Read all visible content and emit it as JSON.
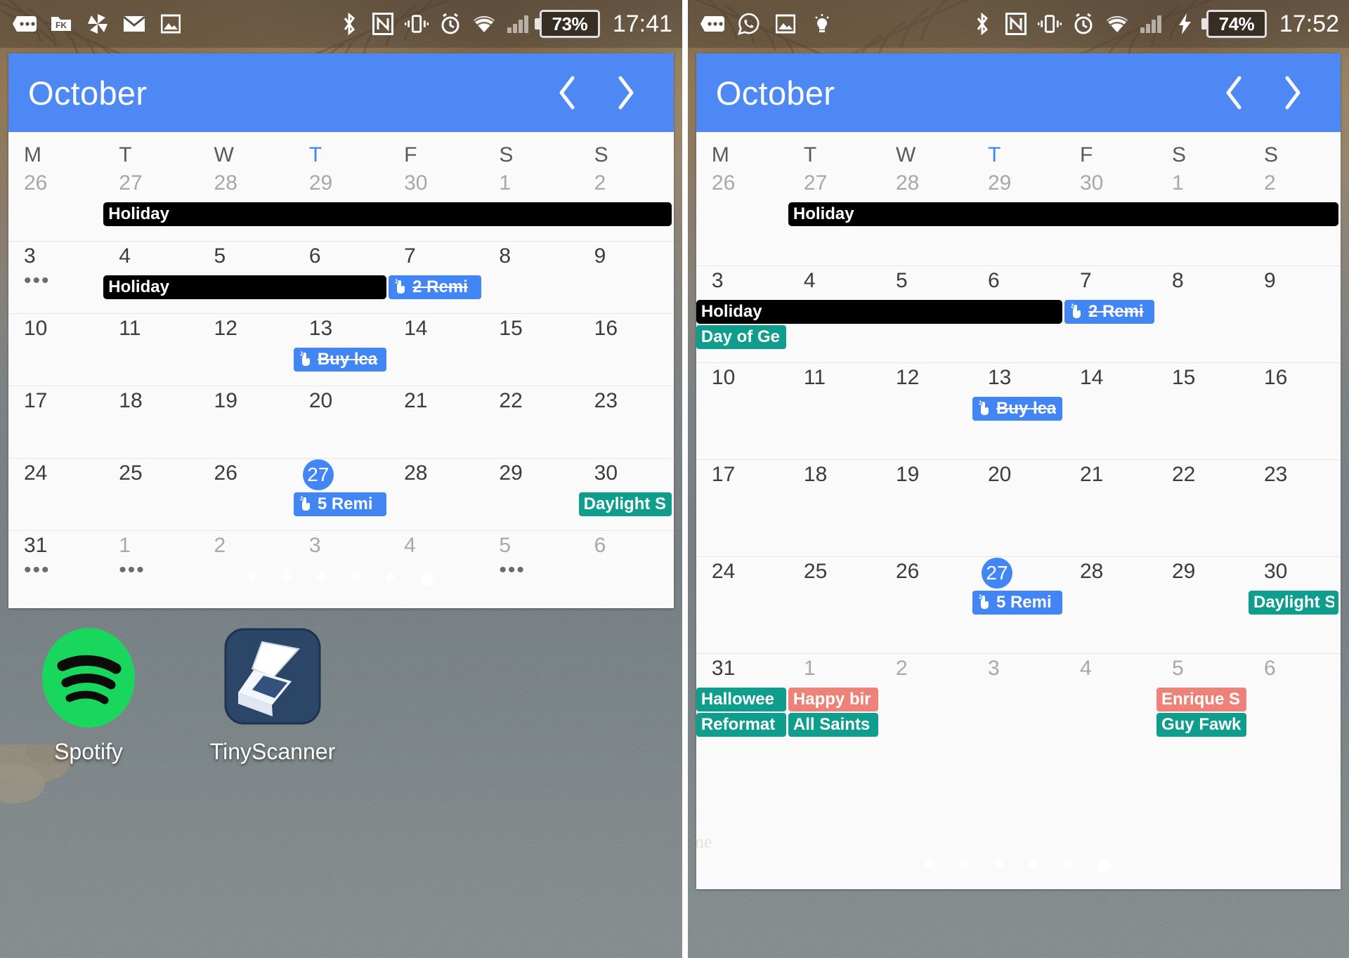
{
  "panels": [
    {
      "id": "left",
      "status_bar": {
        "left_icons": [
          "messages-icon",
          "fk-folder-icon",
          "pinwheel-icon",
          "email-icon",
          "photo-icon"
        ],
        "right_icons": [
          "bluetooth-icon",
          "nfc-icon",
          "vibrate-icon",
          "alarm-icon",
          "wifi-icon",
          "signal-icon"
        ],
        "charging": false,
        "battery": "73%",
        "clock": "17:41"
      },
      "calendar": {
        "title": "October",
        "prev_label": "previous month",
        "next_label": "next month",
        "weekdays": [
          "M",
          "T",
          "W",
          "T",
          "F",
          "S",
          "S"
        ],
        "today_column_index": 3,
        "weeks": [
          {
            "days": [
              {
                "num": "26",
                "out": true
              },
              {
                "num": "27",
                "out": true
              },
              {
                "num": "28",
                "out": true
              },
              {
                "num": "29",
                "out": true
              },
              {
                "num": "30",
                "out": true
              },
              {
                "num": "1",
                "out": true
              },
              {
                "num": "2",
                "out": true
              }
            ],
            "dots": [],
            "chips": [
              {
                "start": 1,
                "span": 6,
                "label": "Holiday",
                "color": "black",
                "icon": null,
                "strike": false
              }
            ]
          },
          {
            "days": [
              {
                "num": "3"
              },
              {
                "num": "4"
              },
              {
                "num": "5"
              },
              {
                "num": "6"
              },
              {
                "num": "7"
              },
              {
                "num": "8"
              },
              {
                "num": "9"
              }
            ],
            "dots": [
              0
            ],
            "chips": [
              {
                "start": 1,
                "span": 3,
                "label": "Holiday",
                "color": "black",
                "icon": null,
                "strike": false
              },
              {
                "start": 4,
                "span": 1,
                "label": "2 Remi",
                "color": "blue",
                "icon": "reminder-hand-icon",
                "strike": true
              }
            ]
          },
          {
            "days": [
              {
                "num": "10"
              },
              {
                "num": "11"
              },
              {
                "num": "12"
              },
              {
                "num": "13"
              },
              {
                "num": "14"
              },
              {
                "num": "15"
              },
              {
                "num": "16"
              }
            ],
            "dots": [],
            "chips": [
              {
                "start": 3,
                "span": 1,
                "label": "Buy lea",
                "color": "blue",
                "icon": "reminder-hand-icon",
                "strike": true
              }
            ]
          },
          {
            "days": [
              {
                "num": "17"
              },
              {
                "num": "18"
              },
              {
                "num": "19"
              },
              {
                "num": "20"
              },
              {
                "num": "21"
              },
              {
                "num": "22"
              },
              {
                "num": "23"
              }
            ],
            "dots": [],
            "chips": []
          },
          {
            "days": [
              {
                "num": "24"
              },
              {
                "num": "25"
              },
              {
                "num": "26"
              },
              {
                "num": "27",
                "today": true
              },
              {
                "num": "28"
              },
              {
                "num": "29"
              },
              {
                "num": "30"
              }
            ],
            "dots": [],
            "chips": [
              {
                "start": 3,
                "span": 1,
                "label": "5 Remi",
                "color": "blue",
                "icon": "reminder-hand-icon",
                "strike": false
              },
              {
                "start": 6,
                "span": 1,
                "label": "Daylight S",
                "color": "teal",
                "icon": null,
                "strike": false
              }
            ]
          },
          {
            "days": [
              {
                "num": "31"
              },
              {
                "num": "1",
                "out": true
              },
              {
                "num": "2",
                "out": true
              },
              {
                "num": "3",
                "out": true
              },
              {
                "num": "4",
                "out": true
              },
              {
                "num": "5",
                "out": true
              },
              {
                "num": "6",
                "out": true
              }
            ],
            "dots": [
              0,
              1,
              5
            ],
            "chips": []
          }
        ]
      },
      "home": {
        "apps": [
          {
            "name": "Spotify",
            "icon": "spotify-icon"
          },
          {
            "name": "TinyScanner",
            "icon": "tinyscanner-icon"
          }
        ],
        "page_dots": 6,
        "active_dot": 5
      }
    },
    {
      "id": "right",
      "status_bar": {
        "left_icons": [
          "messages-icon",
          "whatsapp-icon",
          "photo-icon",
          "lightbulb-icon"
        ],
        "right_icons": [
          "bluetooth-icon",
          "nfc-icon",
          "vibrate-icon",
          "alarm-icon",
          "wifi-icon",
          "signal-icon"
        ],
        "charging": true,
        "battery": "74%",
        "clock": "17:52"
      },
      "calendar": {
        "title": "October",
        "prev_label": "previous month",
        "next_label": "next month",
        "weekdays": [
          "M",
          "T",
          "W",
          "T",
          "F",
          "S",
          "S"
        ],
        "today_column_index": 3,
        "weeks": [
          {
            "days": [
              {
                "num": "26",
                "out": true
              },
              {
                "num": "27",
                "out": true
              },
              {
                "num": "28",
                "out": true
              },
              {
                "num": "29",
                "out": true
              },
              {
                "num": "30",
                "out": true
              },
              {
                "num": "1",
                "out": true
              },
              {
                "num": "2",
                "out": true
              }
            ],
            "dots": [],
            "chips": [
              {
                "start": 1,
                "span": 6,
                "label": "Holiday",
                "color": "black",
                "icon": null,
                "strike": false
              }
            ]
          },
          {
            "days": [
              {
                "num": "3"
              },
              {
                "num": "4"
              },
              {
                "num": "5"
              },
              {
                "num": "6"
              },
              {
                "num": "7"
              },
              {
                "num": "8"
              },
              {
                "num": "9"
              }
            ],
            "dots": [],
            "chips": [
              {
                "start": 0,
                "span": 4,
                "label": "Holiday",
                "color": "black",
                "icon": null,
                "strike": false
              },
              {
                "start": 4,
                "span": 1,
                "label": "2 Remi",
                "color": "blue",
                "icon": "reminder-hand-icon",
                "strike": true
              },
              {
                "start": 0,
                "span": 1,
                "label": "Day of Ge",
                "color": "teal",
                "icon": null,
                "strike": false,
                "row": 1
              }
            ]
          },
          {
            "days": [
              {
                "num": "10"
              },
              {
                "num": "11"
              },
              {
                "num": "12"
              },
              {
                "num": "13"
              },
              {
                "num": "14"
              },
              {
                "num": "15"
              },
              {
                "num": "16"
              }
            ],
            "dots": [],
            "chips": [
              {
                "start": 3,
                "span": 1,
                "label": "Buy lea",
                "color": "blue",
                "icon": "reminder-hand-icon",
                "strike": true
              }
            ]
          },
          {
            "days": [
              {
                "num": "17"
              },
              {
                "num": "18"
              },
              {
                "num": "19"
              },
              {
                "num": "20"
              },
              {
                "num": "21"
              },
              {
                "num": "22"
              },
              {
                "num": "23"
              }
            ],
            "dots": [],
            "chips": []
          },
          {
            "days": [
              {
                "num": "24"
              },
              {
                "num": "25"
              },
              {
                "num": "26"
              },
              {
                "num": "27",
                "today": true
              },
              {
                "num": "28"
              },
              {
                "num": "29"
              },
              {
                "num": "30"
              }
            ],
            "dots": [],
            "chips": [
              {
                "start": 3,
                "span": 1,
                "label": "5 Remi",
                "color": "blue",
                "icon": "reminder-hand-icon",
                "strike": false
              },
              {
                "start": 6,
                "span": 1,
                "label": "Daylight S",
                "color": "teal",
                "icon": null,
                "strike": false
              }
            ]
          },
          {
            "days": [
              {
                "num": "31"
              },
              {
                "num": "1",
                "out": true
              },
              {
                "num": "2",
                "out": true
              },
              {
                "num": "3",
                "out": true
              },
              {
                "num": "4",
                "out": true
              },
              {
                "num": "5",
                "out": true
              },
              {
                "num": "6",
                "out": true
              }
            ],
            "dots": [],
            "chips": [
              {
                "start": 0,
                "span": 1,
                "label": "Hallowee",
                "color": "teal",
                "icon": null,
                "strike": false
              },
              {
                "start": 1,
                "span": 1,
                "label": "Happy bir",
                "color": "salmon",
                "icon": null,
                "strike": false
              },
              {
                "start": 5,
                "span": 1,
                "label": "Enrique S",
                "color": "salmon",
                "icon": null,
                "strike": false
              },
              {
                "start": 0,
                "span": 1,
                "label": "Reformat",
                "color": "teal",
                "icon": null,
                "strike": false,
                "row": 1
              },
              {
                "start": 1,
                "span": 1,
                "label": "All Saints",
                "color": "teal",
                "icon": null,
                "strike": false,
                "row": 1
              },
              {
                "start": 5,
                "span": 1,
                "label": "Guy Fawk",
                "color": "teal",
                "icon": null,
                "strike": false,
                "row": 1
              }
            ]
          }
        ]
      },
      "home": {
        "apps": [],
        "page_dots": 6,
        "active_dot": 5,
        "watermark": "ne"
      }
    }
  ],
  "colors": {
    "header_blue": "#4d88f5",
    "today_blue": "#4285f4",
    "chip_blue": "#4285f4",
    "chip_teal": "#0f9d8e",
    "chip_salmon": "#ef8278",
    "chip_black": "#000000",
    "calendar_bg": "#fafafa"
  }
}
